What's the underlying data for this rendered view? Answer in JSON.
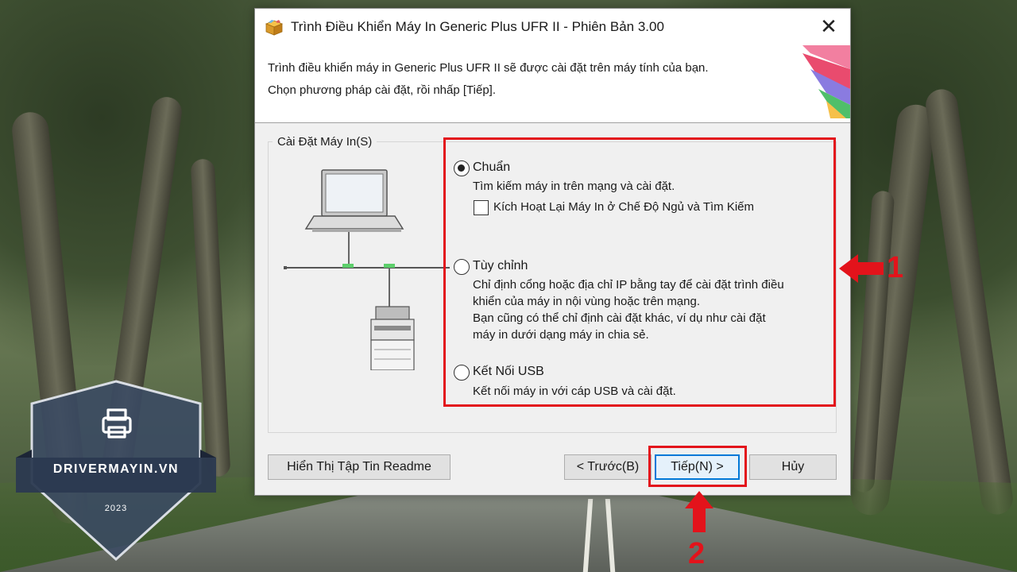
{
  "window": {
    "title": "Trình Điều Khiển Máy In Generic Plus UFR II - Phiên Bản 3.00",
    "close_glyph": "✕",
    "title_icon": "package-icon"
  },
  "header": {
    "line1": "Trình điều khiển máy in Generic Plus UFR II sẽ được cài đặt trên máy tính của bạn.",
    "line2": "Chọn phương pháp cài đặt, rồi nhấp [Tiếp]."
  },
  "group": {
    "title": "Cài Đặt Máy In(S)"
  },
  "options": {
    "standard": {
      "label": "Chuẩn",
      "selected": true,
      "desc": "Tìm kiếm máy in trên mạng và cài đặt.",
      "checkbox_label": "Kích Hoạt Lại Máy In ở Chế Độ Ngủ và Tìm Kiếm",
      "checkbox_checked": false
    },
    "custom": {
      "label": "Tùy chỉnh",
      "selected": false,
      "desc1": "Chỉ định cổng hoặc địa chỉ IP bằng tay để cài đặt trình điều",
      "desc2": "khiển của máy in nội vùng hoặc trên mạng.",
      "desc3": "Bạn cũng có thể chỉ định cài đặt khác, ví dụ như cài đặt",
      "desc4": "máy in dưới dạng máy in chia sẻ."
    },
    "usb": {
      "label": "Kết Nối USB",
      "selected": false,
      "desc": "Kết nối máy in với cáp USB và cài đặt."
    }
  },
  "buttons": {
    "readme": "Hiển Thị Tập Tin Readme",
    "back": "< Trước(B)",
    "next": "Tiếp(N) >",
    "cancel": "Hủy"
  },
  "annotations": {
    "marker1": "1",
    "marker2": "2",
    "highlight_color": "#e3131b"
  },
  "badge": {
    "site": "DRIVERMAYIN.VN",
    "year": "2023",
    "icon": "printer-icon"
  },
  "colors": {
    "dialog_bg": "#f0f0f0",
    "default_button_border": "#0078d7"
  }
}
